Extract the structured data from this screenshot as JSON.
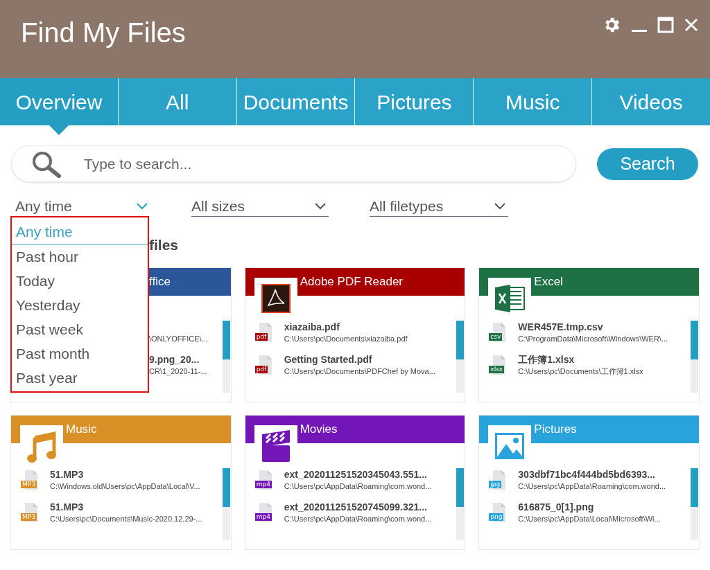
{
  "window": {
    "title": "Find My Files"
  },
  "tabs": [
    {
      "label": "Overview",
      "selected": true
    },
    {
      "label": "All",
      "selected": false
    },
    {
      "label": "Documents",
      "selected": false
    },
    {
      "label": "Pictures",
      "selected": false
    },
    {
      "label": "Music",
      "selected": false
    },
    {
      "label": "Videos",
      "selected": false
    }
  ],
  "search": {
    "placeholder": "Type to search...",
    "button": "Search"
  },
  "filters": [
    {
      "value": "Any time",
      "expanded": true,
      "options": [
        {
          "label": "Any time",
          "selected": true
        },
        {
          "label": "Past hour",
          "selected": false
        },
        {
          "label": "Today",
          "selected": false
        },
        {
          "label": "Yesterday",
          "selected": false
        },
        {
          "label": "Past week",
          "selected": false
        },
        {
          "label": "Past month",
          "selected": false
        },
        {
          "label": "Past year",
          "selected": false
        }
      ]
    },
    {
      "value": "All sizes",
      "expanded": false
    },
    {
      "value": "All filetypes",
      "expanded": false
    }
  ],
  "section_heading": "files",
  "cards": [
    {
      "kind": "office",
      "title": "ffice",
      "color": "#2b579a",
      "files": [
        {
          "path": "\\ONLYOFFICE\\..."
        },
        {
          "name": "9.png_20...",
          "path": "CR\\1_2020-11-..."
        }
      ]
    },
    {
      "kind": "pdf",
      "title": "Adobe PDF Reader",
      "color": "#a80000",
      "files": [
        {
          "name": "xiazaiba.pdf",
          "path": "C:\\Users\\pc\\Documents\\xiazaiba.pdf",
          "ext": "pdf"
        },
        {
          "name": "Getting Started.pdf",
          "path": "C:\\Users\\pc\\Documents\\PDFChef by Mova...",
          "ext": "pdf"
        }
      ]
    },
    {
      "kind": "excel",
      "title": "Excel",
      "color": "#1e7145",
      "files": [
        {
          "name": "WER457E.tmp.csv",
          "path": "C:\\ProgramData\\Microsoft\\Windows\\WER\\...",
          "ext": "csv"
        },
        {
          "name": "工作簿1.xlsx",
          "path": "C:\\Users\\pc\\Documents\\工作簿1.xlsx",
          "ext": "xlsx"
        }
      ]
    },
    {
      "kind": "music",
      "title": "Music",
      "color": "#d99027",
      "files": [
        {
          "name": "51.MP3",
          "path": "C:\\Windows.old\\Users\\pc\\AppData\\Local\\V...",
          "ext": "MP3"
        },
        {
          "name": "51.MP3",
          "path": "C:\\Users\\pc\\Documents\\Music-2020.12.29-...",
          "ext": "MP3"
        }
      ]
    },
    {
      "kind": "movies",
      "title": "Movies",
      "color": "#7216b8",
      "files": [
        {
          "name": "ext_202011251520345043.551...",
          "path": "C:\\Users\\pc\\AppData\\Roaming\\com.wond...",
          "ext": "mp4"
        },
        {
          "name": "ext_202011251520745099.321...",
          "path": "C:\\Users\\pc\\AppData\\Roaming\\com.wond...",
          "ext": "mp4"
        }
      ]
    },
    {
      "kind": "pictures",
      "title": "Pictures",
      "color": "#29a3dc",
      "files": [
        {
          "name": "303dbf71bc4f444bd5bd6393...",
          "path": "C:\\Users\\pc\\AppData\\Roaming\\com.wond...",
          "ext": "jpg"
        },
        {
          "name": "616875_0[1].png",
          "path": "C:\\Users\\pc\\AppData\\Local\\Microsoft\\Wi...",
          "ext": "png"
        }
      ]
    }
  ]
}
